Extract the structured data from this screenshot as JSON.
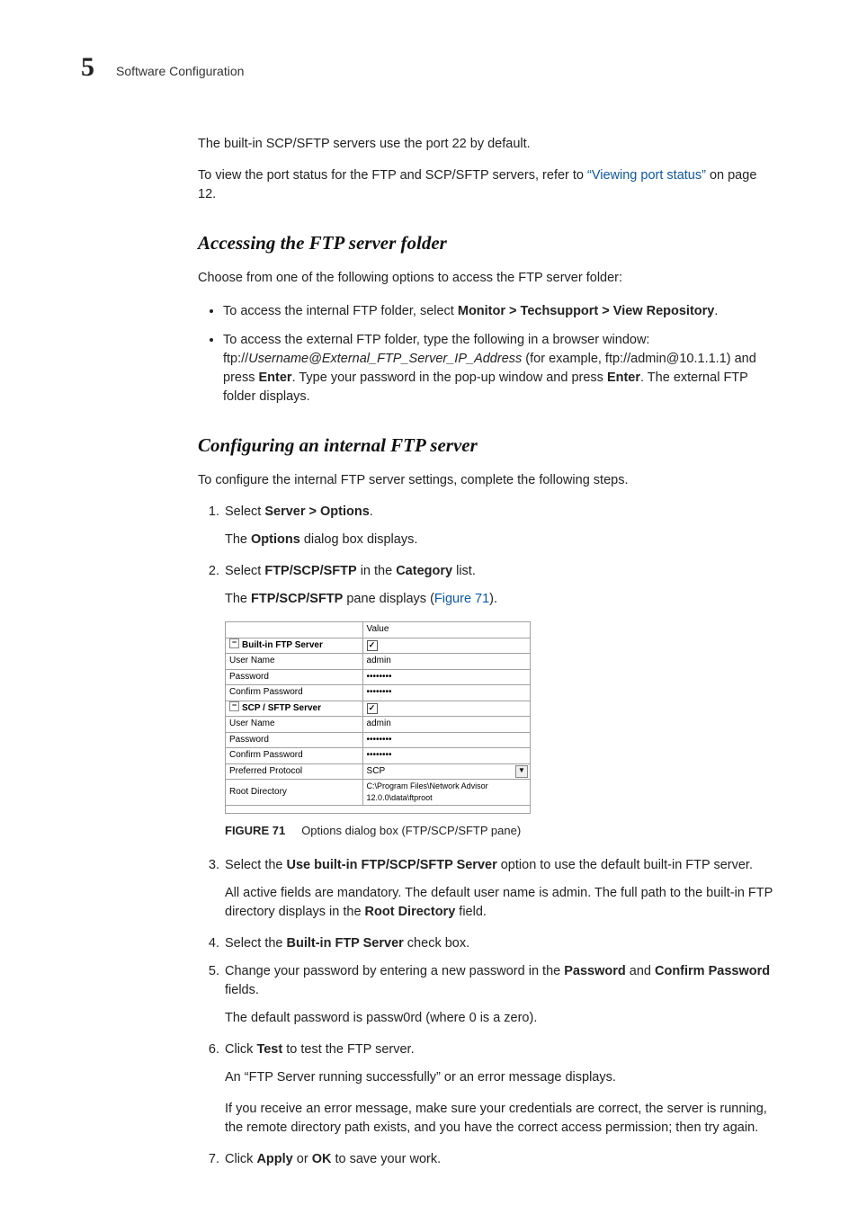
{
  "header": {
    "chapter_number": "5",
    "chapter_title": "Software Configuration"
  },
  "intro": {
    "p1": "The built-in SCP/SFTP servers use the port 22 by default.",
    "p2a": "To view the port status for the FTP and SCP/SFTP servers, refer to ",
    "p2_link": "“Viewing port status”",
    "p2b": " on page 12."
  },
  "sec1": {
    "heading": "Accessing the FTP server folder",
    "lead": "Choose from one of the following options to access the FTP server folder:",
    "b1a": "To access the internal FTP folder, select ",
    "b1b": "Monitor > Techsupport > View Repository",
    "b1c": ".",
    "b2a": "To access the external FTP folder, type the following in a browser window: ftp://",
    "b2i": "Username@External_FTP_Server_IP_Address",
    "b2b": " (for example, ftp://admin@10.1.1.1) and press ",
    "b2c": "Enter",
    "b2d": ". Type your password in the pop-up window and press ",
    "b2e": "Enter",
    "b2f": ". The external FTP folder displays."
  },
  "sec2": {
    "heading": "Configuring an internal FTP server",
    "lead": "To configure the internal FTP server settings, complete the following steps.",
    "s1a": "Select ",
    "s1b": "Server > Options",
    "s1c": ".",
    "s1sub_a": "The ",
    "s1sub_b": "Options",
    "s1sub_c": " dialog box displays.",
    "s2a": "Select ",
    "s2b": "FTP/SCP/SFTP",
    "s2c": " in the ",
    "s2d": "Category",
    "s2e": " list.",
    "s2sub_a": "The ",
    "s2sub_b": "FTP/SCP/SFTP",
    "s2sub_c": " pane displays (",
    "s2sub_link": "Figure 71",
    "s2sub_d": ").",
    "s3a": "Select the ",
    "s3b": "Use built-in FTP/SCP/SFTP Server",
    "s3c": " option to use the default built-in FTP server.",
    "s3sub_a": "All active fields are mandatory. The default user name is admin. The full path to the built-in FTP directory displays in the ",
    "s3sub_b": "Root Directory",
    "s3sub_c": " field.",
    "s4a": "Select the ",
    "s4b": "Built-in FTP Server",
    "s4c": " check box.",
    "s5a": "Change your password by entering a new password in the ",
    "s5b": "Password",
    "s5c": " and ",
    "s5d": "Confirm Password",
    "s5e": " fields.",
    "s5sub": "The default password is passw0rd (where 0 is a zero).",
    "s6a": "Click ",
    "s6b": "Test",
    "s6c": " to test the FTP server.",
    "s6sub1": "An “FTP Server running successfully” or an error message displays.",
    "s6sub2": "If you receive an error message, make sure your credentials are correct, the server is running, the remote directory path exists, and you have the correct access permission; then try again.",
    "s7a": "Click ",
    "s7b": "Apply",
    "s7c": " or ",
    "s7d": "OK",
    "s7e": " to save your work."
  },
  "figure": {
    "label": "FIGURE 71",
    "caption": "Options dialog box (FTP/SCP/SFTP pane)",
    "value_header": "Value",
    "twisty": "−",
    "row_ftp": "Built-in FTP Server",
    "row_user": "User Name",
    "row_pass": "Password",
    "row_conf": "Confirm Password",
    "row_scp": "SCP / SFTP Server",
    "row_pref": "Preferred Protocol",
    "row_root": "Root Directory",
    "val_admin": "admin",
    "val_dots": "••••••••",
    "val_scp": "SCP",
    "val_root": "C:\\Program Files\\Network Advisor 12.0.0\\data\\ftproot",
    "check": "✓",
    "dd": "▼"
  }
}
